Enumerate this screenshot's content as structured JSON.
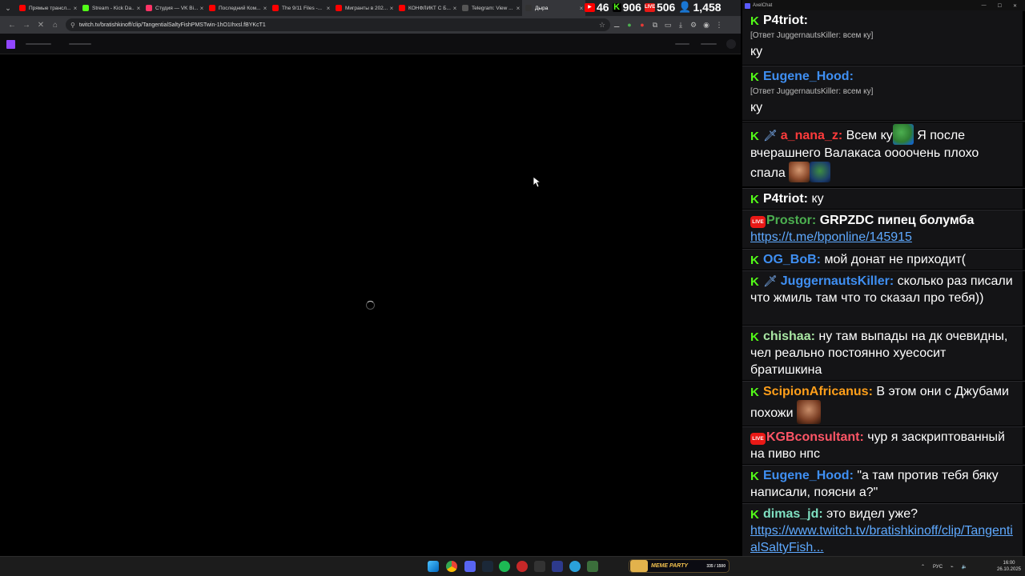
{
  "browser": {
    "tabs": [
      {
        "title": "Прямые трансл...",
        "favicon": "youtube-icon",
        "color": "#ff0000",
        "active": false
      },
      {
        "title": "Stream - Kick Da...",
        "favicon": "kick-icon",
        "color": "#53fc18",
        "active": false
      },
      {
        "title": "Студия — VK Bi...",
        "favicon": "vk-icon",
        "color": "#ff3366",
        "active": false
      },
      {
        "title": "Последний Ком...",
        "favicon": "youtube-icon",
        "color": "#ff0000",
        "active": false
      },
      {
        "title": "The 9/11 Files -...",
        "favicon": "youtube-icon",
        "color": "#ff0000",
        "active": false
      },
      {
        "title": "Мигранты в 202...",
        "favicon": "youtube-icon",
        "color": "#ff0000",
        "active": false
      },
      {
        "title": "КОНФЛИКТ С Б...",
        "favicon": "youtube-icon",
        "color": "#ff0000",
        "active": false
      },
      {
        "title": "Telegram: View ...",
        "favicon": "telegram-icon",
        "color": "#555555",
        "active": false
      },
      {
        "title": "Дыра",
        "favicon": "twitch-icon",
        "color": "#333333",
        "active": true
      }
    ],
    "url": "twitch.tv/bratishkinoff/clip/TangentialSaltyFishPMSTwin-1hO1Ihxsl.fBYKcT1",
    "stats": {
      "youtube_viewers": "46",
      "kick_viewers": "906",
      "vklive_viewers": "506",
      "total_viewers": "1,458"
    }
  },
  "chat": {
    "window_title": "AxelChat",
    "messages": [
      {
        "platform": "kick",
        "nick": "P4triot:",
        "nick_color": "#ffffff",
        "text": "",
        "reply": "[Ответ JuggernautsKiller: всем ку]",
        "text2": "ку"
      },
      {
        "platform": "kick",
        "nick": "Eugene_Hood:",
        "nick_color": "#3f8ff2",
        "reply": "[Ответ JuggernautsKiller: всем ку]",
        "text2": "ку"
      },
      {
        "platform": "kick",
        "nick": "a_nana_z:",
        "nick_color": "#ff3b3b",
        "text_a": "Всем ку",
        "text_b": "Я после вчерашнего Валакаса оооочень плохо спала"
      },
      {
        "platform": "kick",
        "nick": "P4triot:",
        "nick_color": "#ffffff",
        "text": "ку"
      },
      {
        "platform": "live",
        "nick": "Prostor:",
        "nick_color": "#4caf50",
        "text": "GRPZDC пипец болумба",
        "link": "https://t.me/bponline/145915"
      },
      {
        "platform": "kick",
        "nick": "OG_BoB:",
        "nick_color": "#3f8ff2",
        "text": "мой донат не приходит("
      },
      {
        "platform": "kick",
        "nick": "JuggernautsKiller:",
        "nick_color": "#3f8ff2",
        "text": "сколько раз писали что жмиль там что то сказал про тебя))"
      },
      {
        "platform": "kick",
        "nick": "chishaa:",
        "nick_color": "#a8e6a3",
        "text": "ну там выпады на дк очевидны, чел реально постоянно хуесосит братишкина"
      },
      {
        "platform": "kick",
        "nick": "ScipionAfricanus:",
        "nick_color": "#ff9f1a",
        "text": "В этом они с Джубами похожи"
      },
      {
        "platform": "live",
        "nick": "KGBconsultant:",
        "nick_color": "#ff5566",
        "text": "чур я заскриптованный на пиво нпс"
      },
      {
        "platform": "kick",
        "nick": "Eugene_Hood:",
        "nick_color": "#3f8ff2",
        "text": "\"а там против тебя бяку написали, поясни а?\""
      },
      {
        "platform": "kick",
        "nick": "dimas_jd:",
        "nick_color": "#7fe0c2",
        "text": "это видел уже?",
        "link": "https://www.twitch.tv/bratishkinoff/clip/TangentialSaltyFish..."
      }
    ]
  },
  "taskbar": {
    "party_name": "MEME PARTY",
    "party_count": "335 / 1500",
    "lang": "РУС",
    "time": "16:00",
    "date": "26.10.2025"
  }
}
